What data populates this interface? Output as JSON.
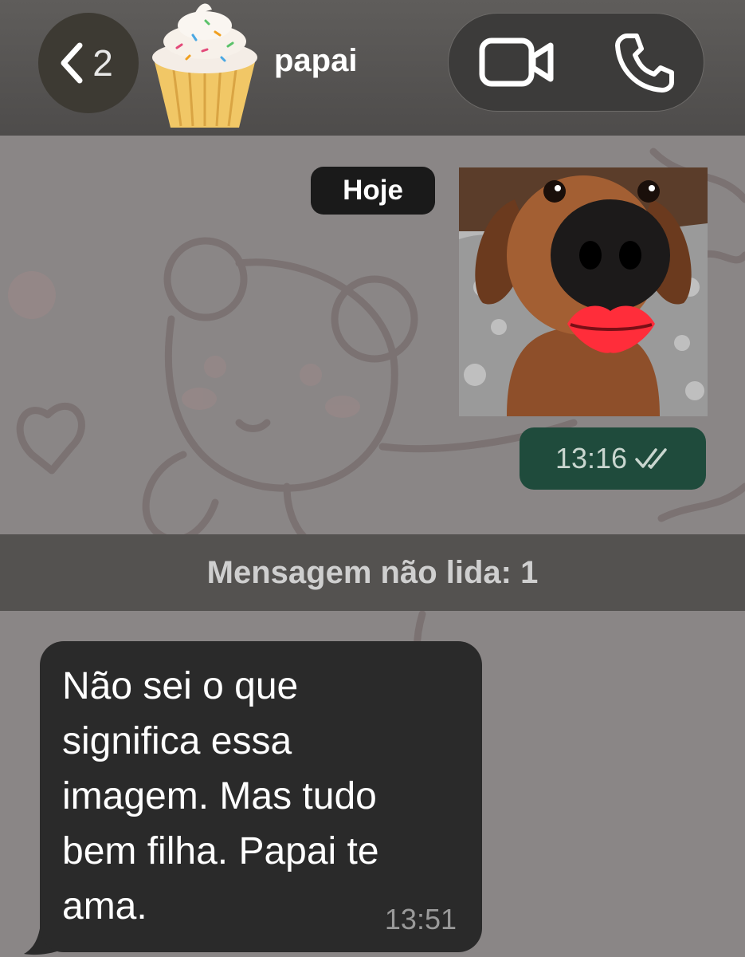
{
  "header": {
    "back_count": "2",
    "contact_name": "papai",
    "avatar_icon": "cupcake-icon",
    "video_icon": "video-camera-icon",
    "call_icon": "phone-icon"
  },
  "chat": {
    "date_chip": "Hoje",
    "sticker": {
      "description_icon": "dog-kiss-sticker",
      "time": "13:16",
      "status_icon": "double-check-icon"
    },
    "unread_banner": "Mensagem não lida: 1",
    "incoming_message": {
      "text": "Não sei o que\nsignifica essa\nimagem. Mas tudo\nbem filha.  Papai te\nama.",
      "time": "13:51"
    }
  },
  "colors": {
    "header_bg": "#56544f",
    "chat_bg": "#8a8686",
    "outgoing_bubble": "#1f4b3c",
    "incoming_bubble": "#2a2a2a",
    "date_chip_bg": "#1a1a1a"
  }
}
